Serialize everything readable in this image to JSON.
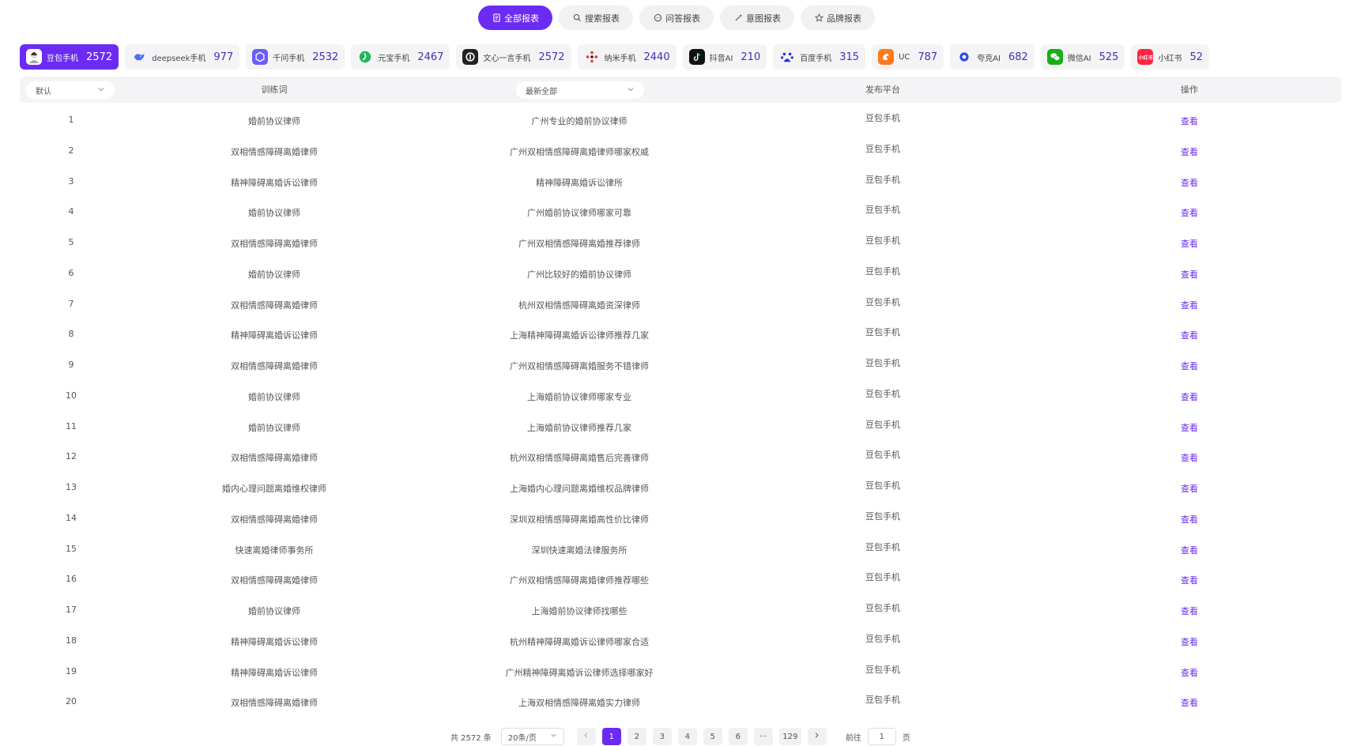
{
  "tabs": [
    {
      "label": "全部报表",
      "icon": "document-icon",
      "active": true
    },
    {
      "label": "搜索报表",
      "icon": "search-icon",
      "active": false
    },
    {
      "label": "问答报表",
      "icon": "chat-icon",
      "active": false
    },
    {
      "label": "意图报表",
      "icon": "magic-wand-icon",
      "active": false
    },
    {
      "label": "品牌报表",
      "icon": "star-icon",
      "active": false
    }
  ],
  "platforms": [
    {
      "name": "豆包手机",
      "count": "2572",
      "logo_color": "#ffffff",
      "logo_text": "",
      "active": true
    },
    {
      "name": "deepseek手机",
      "count": "977",
      "logo_color": "#4d6bfe",
      "logo_text": "",
      "active": false
    },
    {
      "name": "千问手机",
      "count": "2532",
      "logo_color": "#6b5cff",
      "logo_text": "",
      "active": false
    },
    {
      "name": "元宝手机",
      "count": "2467",
      "logo_color": "#1fb85a",
      "logo_text": "",
      "active": false
    },
    {
      "name": "文心一言手机",
      "count": "2572",
      "logo_color": "#222222",
      "logo_text": "",
      "active": false
    },
    {
      "name": "纳米手机",
      "count": "2440",
      "logo_color": "#ffffff",
      "logo_text": "",
      "active": false
    },
    {
      "name": "抖音AI",
      "count": "210",
      "logo_color": "#111111",
      "logo_text": "",
      "active": false
    },
    {
      "name": "百度手机",
      "count": "315",
      "logo_color": "#ffffff",
      "logo_text": "",
      "active": false
    },
    {
      "name": "UC",
      "count": "787",
      "logo_color": "#ff7a1a",
      "logo_text": "",
      "active": false
    },
    {
      "name": "夸克AI",
      "count": "682",
      "logo_color": "#ffffff",
      "logo_text": "",
      "active": false
    },
    {
      "name": "微信AI",
      "count": "525",
      "logo_color": "#1aad19",
      "logo_text": "",
      "active": false
    },
    {
      "name": "小红书",
      "count": "52",
      "logo_color": "#ff2442",
      "logo_text": "小红书",
      "active": false
    }
  ],
  "table": {
    "sort_select": "默认",
    "filter_select": "最新全部",
    "headers": {
      "keyword": "训练词",
      "platform": "发布平台",
      "action": "操作"
    },
    "rows": [
      {
        "idx": "1",
        "keyword": "婚前协议律师",
        "query": "广州专业的婚前协议律师",
        "platform": "豆包手机",
        "action": "查看"
      },
      {
        "idx": "2",
        "keyword": "双相情感障碍离婚律师",
        "query": "广州双相情感障碍离婚律师哪家权威",
        "platform": "豆包手机",
        "action": "查看"
      },
      {
        "idx": "3",
        "keyword": "精神障碍离婚诉讼律师",
        "query": "精神障碍离婚诉讼律所",
        "platform": "豆包手机",
        "action": "查看"
      },
      {
        "idx": "4",
        "keyword": "婚前协议律师",
        "query": "广州婚前协议律师哪家可靠",
        "platform": "豆包手机",
        "action": "查看"
      },
      {
        "idx": "5",
        "keyword": "双相情感障碍离婚律师",
        "query": "广州双相情感障碍离婚推荐律师",
        "platform": "豆包手机",
        "action": "查看"
      },
      {
        "idx": "6",
        "keyword": "婚前协议律师",
        "query": "广州比较好的婚前协议律师",
        "platform": "豆包手机",
        "action": "查看"
      },
      {
        "idx": "7",
        "keyword": "双相情感障碍离婚律师",
        "query": "杭州双相情感障碍离婚资深律师",
        "platform": "豆包手机",
        "action": "查看"
      },
      {
        "idx": "8",
        "keyword": "精神障碍离婚诉讼律师",
        "query": "上海精神障碍离婚诉讼律师推荐几家",
        "platform": "豆包手机",
        "action": "查看"
      },
      {
        "idx": "9",
        "keyword": "双相情感障碍离婚律师",
        "query": "广州双相情感障碍离婚服务不错律师",
        "platform": "豆包手机",
        "action": "查看"
      },
      {
        "idx": "10",
        "keyword": "婚前协议律师",
        "query": "上海婚前协议律师哪家专业",
        "platform": "豆包手机",
        "action": "查看"
      },
      {
        "idx": "11",
        "keyword": "婚前协议律师",
        "query": "上海婚前协议律师推荐几家",
        "platform": "豆包手机",
        "action": "查看"
      },
      {
        "idx": "12",
        "keyword": "双相情感障碍离婚律师",
        "query": "杭州双相情感障碍离婚售后完善律师",
        "platform": "豆包手机",
        "action": "查看"
      },
      {
        "idx": "13",
        "keyword": "婚内心理问题离婚维权律师",
        "query": "上海婚内心理问题离婚维权品牌律师",
        "platform": "豆包手机",
        "action": "查看"
      },
      {
        "idx": "14",
        "keyword": "双相情感障碍离婚律师",
        "query": "深圳双相情感障碍离婚高性价比律师",
        "platform": "豆包手机",
        "action": "查看"
      },
      {
        "idx": "15",
        "keyword": "快速离婚律师事务所",
        "query": "深圳快速离婚法律服务所",
        "platform": "豆包手机",
        "action": "查看"
      },
      {
        "idx": "16",
        "keyword": "双相情感障碍离婚律师",
        "query": "广州双相情感障碍离婚律师推荐哪些",
        "platform": "豆包手机",
        "action": "查看"
      },
      {
        "idx": "17",
        "keyword": "婚前协议律师",
        "query": "上海婚前协议律师找哪些",
        "platform": "豆包手机",
        "action": "查看"
      },
      {
        "idx": "18",
        "keyword": "精神障碍离婚诉讼律师",
        "query": "杭州精神障碍离婚诉讼律师哪家合适",
        "platform": "豆包手机",
        "action": "查看"
      },
      {
        "idx": "19",
        "keyword": "精神障碍离婚诉讼律师",
        "query": "广州精神障碍离婚诉讼律师选择哪家好",
        "platform": "豆包手机",
        "action": "查看"
      },
      {
        "idx": "20",
        "keyword": "双相情感障碍离婚律师",
        "query": "上海双相情感障碍离婚实力律师",
        "platform": "豆包手机",
        "action": "查看"
      }
    ]
  },
  "pagination": {
    "total": "共 2572 条",
    "page_size": "20条/页",
    "pages": [
      "1",
      "2",
      "3",
      "4",
      "5",
      "6"
    ],
    "ellipsis": "···",
    "last_page": "129",
    "current": "1",
    "goto_label": "前往",
    "goto_value": "1",
    "goto_suffix": "页"
  },
  "colors": {
    "accent": "#6c2bf2",
    "header_bg": "#f4f4f6"
  }
}
